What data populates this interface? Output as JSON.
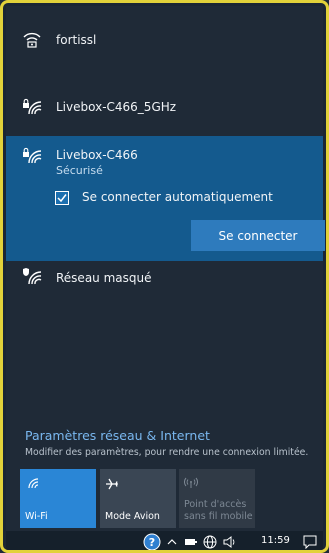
{
  "networks": [
    {
      "name": "fortissl",
      "secured": false
    },
    {
      "name": "Livebox-C466_5GHz",
      "secured": true
    },
    {
      "name": "Livebox-C466",
      "secured": true,
      "status": "Sécurisé",
      "selected": true
    },
    {
      "name": "Réseau masqué",
      "secured": true,
      "shield": true
    }
  ],
  "selected": {
    "auto_connect_label": "Se connecter automatiquement",
    "auto_connect_checked": true,
    "connect_button": "Se connecter"
  },
  "settings": {
    "title": "Paramètres réseau & Internet",
    "subtitle": "Modifier des paramètres, pour rendre une connexion limitée."
  },
  "tiles": [
    {
      "label": "Wi-Fi",
      "active": true,
      "icon": "wifi-icon"
    },
    {
      "label": "Mode Avion",
      "active": false,
      "icon": "airplane-icon"
    },
    {
      "label": "Point d'accès sans fil mobile",
      "label_line1": "Point d'accès",
      "label_line2": "sans fil mobile",
      "active": false,
      "disabled": true,
      "icon": "hotspot-icon"
    }
  ],
  "taskbar": {
    "time": "11:59",
    "icons": [
      "help-icon",
      "chevron-up-icon",
      "battery-icon",
      "globe-icon",
      "speaker-icon",
      "notification-icon"
    ]
  },
  "colors": {
    "accent": "#2a86d6",
    "selected_bg": "#145a8e",
    "link": "#7ab8f0",
    "frame": "#e2d23a"
  }
}
